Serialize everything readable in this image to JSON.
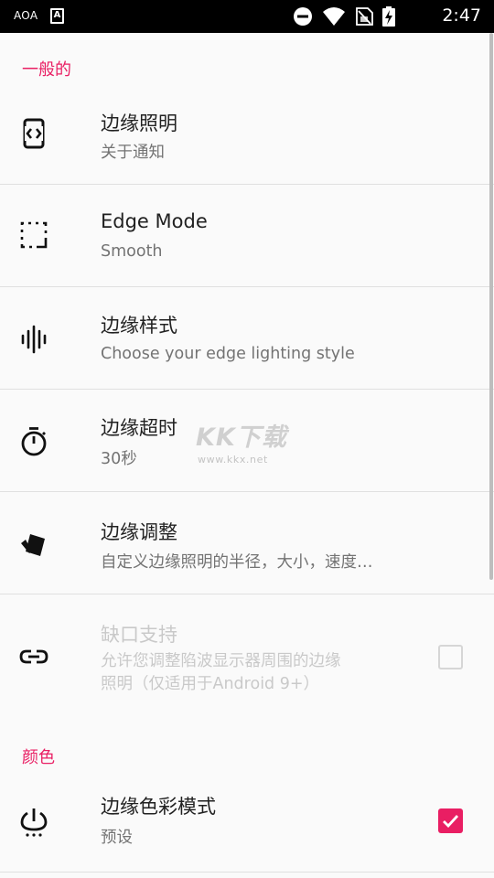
{
  "status_bar": {
    "carrier": "AOA",
    "app_icon_letter": "A",
    "time": "2:47",
    "icons": [
      "do-not-disturb-icon",
      "wifi-icon",
      "no-sim-icon",
      "battery-charging-icon"
    ]
  },
  "sections": {
    "general": "一般的",
    "color": "颜色"
  },
  "items": [
    {
      "title": "边缘照明",
      "subtitle": "关于通知",
      "icon": "device-code-icon"
    },
    {
      "title": "Edge Mode",
      "subtitle": "Smooth",
      "icon": "dashed-corner-icon"
    },
    {
      "title": "边缘样式",
      "subtitle": "Choose your edge lighting style",
      "icon": "waveform-icon"
    },
    {
      "title": "边缘超时",
      "subtitle": "30秒",
      "icon": "timer-icon"
    },
    {
      "title": "边缘调整",
      "subtitle": "自定义边缘照明的半径，大小，速度…",
      "icon": "cards-icon"
    },
    {
      "title": "缺口支持",
      "subtitle_line1": "允许您调整陷波显示器周围的边缘",
      "subtitle_line2": "照明（仅适用于Android 9+）",
      "icon": "link-icon",
      "checked": false,
      "enabled": false
    },
    {
      "title": "边缘色彩模式",
      "subtitle": "预设",
      "icon": "power-icon",
      "checked": true
    }
  ],
  "watermark": {
    "big": "KK下载",
    "small": "www.kkx.net"
  },
  "colors": {
    "accent": "#e91e63",
    "status_bar": "#000000",
    "background": "#fafafa"
  }
}
